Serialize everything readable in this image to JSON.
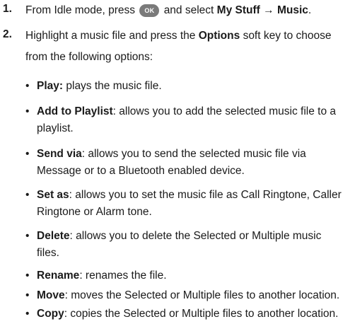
{
  "steps": [
    {
      "num": "1.",
      "p1": "From Idle mode, press",
      "ok_label": "OK",
      "p2": "and select",
      "b1": "My Stuff",
      "arrow": " → ",
      "b2": "Music",
      "p3": "."
    },
    {
      "num": "2.",
      "p1": "Highlight a music file and press the",
      "b1": "Options",
      "p2": "soft key to choose",
      "line2": "from the following options:"
    }
  ],
  "options": [
    {
      "name": "Play:",
      "desc": "plays the music file."
    },
    {
      "name": "Add to Playlist",
      "desc": ": allows you to add the selected music file to a",
      "desc2": "playlist."
    },
    {
      "name": "Send via",
      "desc": ": allows you to send the selected music file via",
      "desc2": "Message or to a Bluetooth enabled device."
    },
    {
      "name": "Set as",
      "desc": ": allows you to set the music file as Call Ringtone, Caller",
      "desc2": "Ringtone or Alarm tone."
    },
    {
      "name": "Delete",
      "desc": ": allows you to delete the Selected or Multiple music",
      "desc2": "files."
    },
    {
      "name": "Rename",
      "desc": ": renames the file."
    },
    {
      "name": "Move",
      "desc": ": moves the Selected or Multiple files to another location."
    },
    {
      "name": "Copy",
      "desc": ": copies the Selected or Multiple files to another location."
    }
  ],
  "bullet_char": "•"
}
